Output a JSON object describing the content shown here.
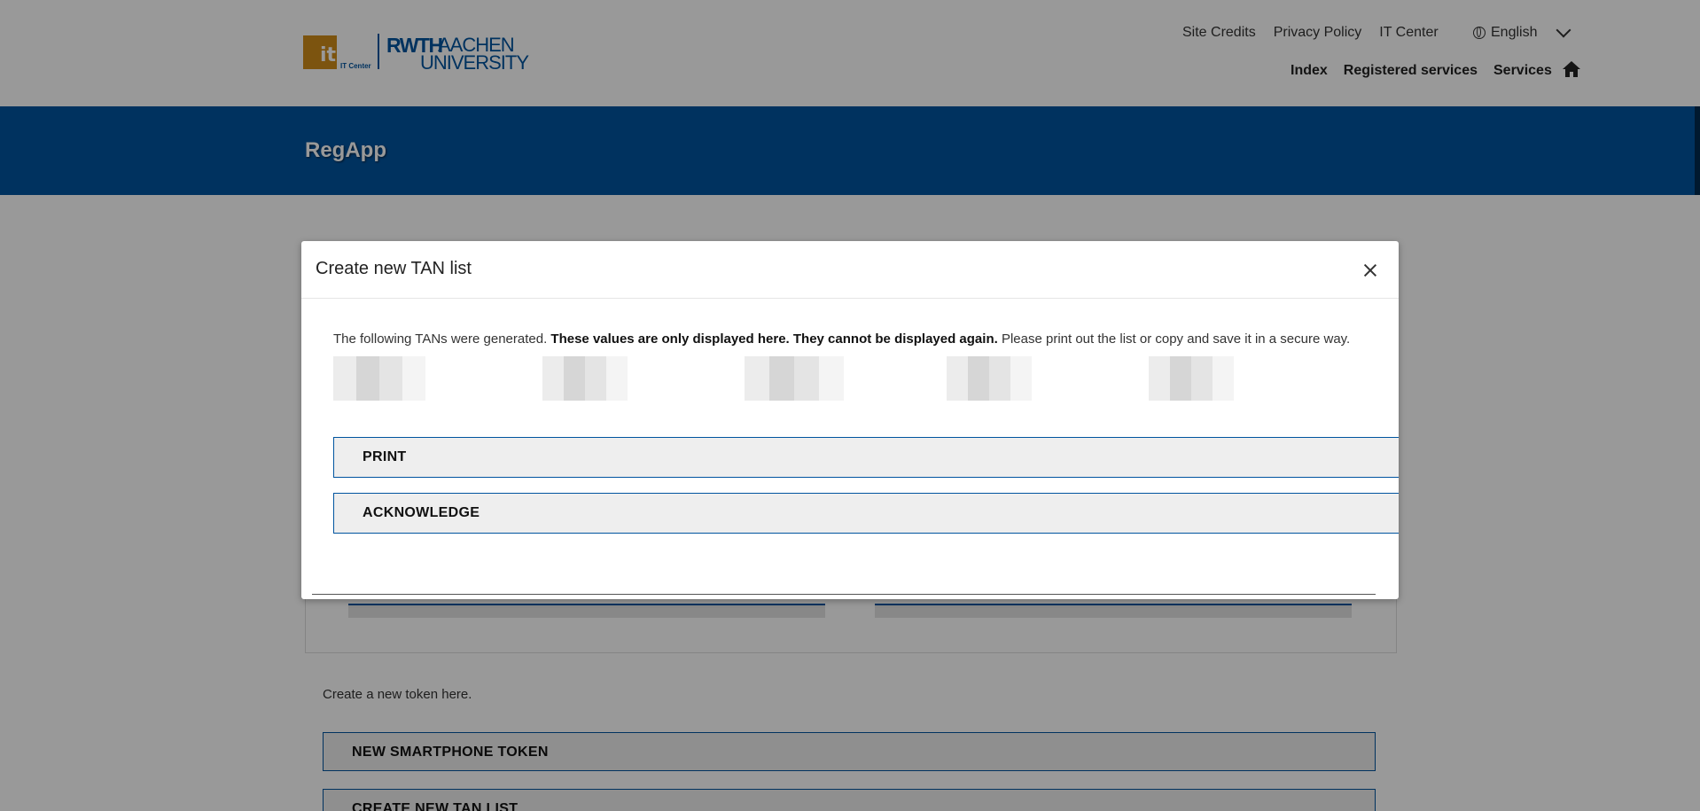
{
  "header": {
    "logo": {
      "it_label": "it",
      "it_center_label": "IT Center",
      "rwth": "RWTH",
      "aachen": "AACHEN",
      "university": "UNIVERSITY"
    },
    "top_links": [
      "Site Credits",
      "Privacy Policy",
      "IT Center"
    ],
    "language": "English",
    "nav": [
      "Index",
      "Registered services",
      "Services"
    ],
    "icons": {
      "language": "globe-icon",
      "language_toggle": "chevron-down-icon",
      "home": "home-icon"
    }
  },
  "banner": {
    "title": "RegApp"
  },
  "background": {
    "create_text": "Create a new token here.",
    "buttons": [
      "NEW SMARTPHONE TOKEN",
      "CREATE NEW TAN LIST"
    ]
  },
  "modal": {
    "title": "Create new TAN list",
    "text_start": "The following TANs were generated.",
    "text_bold": "These values are only displayed here. They cannot be displayed again.",
    "text_end": "Please print out the list or copy and save it in a secure way.",
    "buttons": {
      "print": "PRINT",
      "acknowledge": "ACKNOWLEDGE"
    },
    "icons": {
      "close": "close-icon"
    }
  },
  "colors": {
    "brand_blue": "#00549f",
    "brand_orange": "#cf8d1a",
    "overlay": "rgba(0,0,0,0.40)",
    "button_bg": "#eeeeee"
  }
}
